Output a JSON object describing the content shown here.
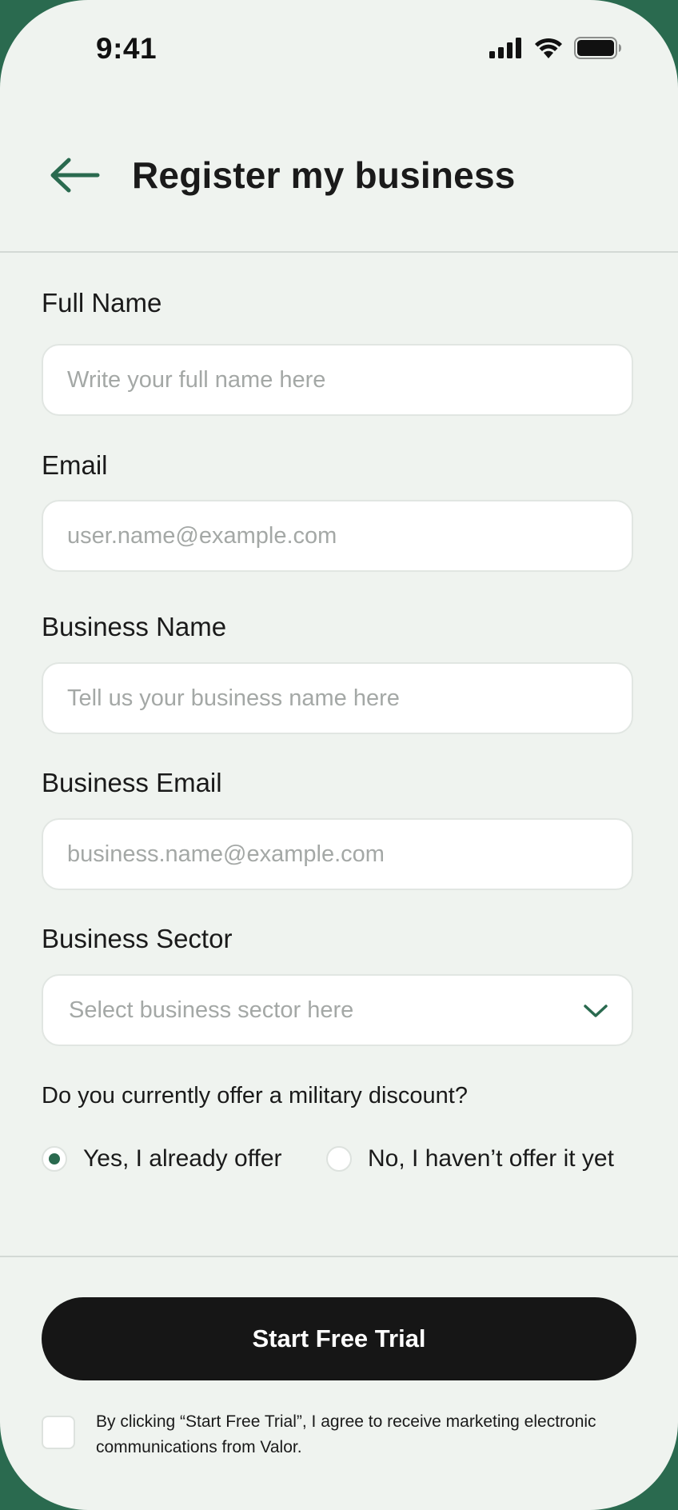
{
  "status_bar": {
    "time": "9:41",
    "icons": [
      "signal-icon",
      "wifi-icon",
      "battery-icon"
    ]
  },
  "header": {
    "back_icon": "arrow-left-icon",
    "title": "Register my business"
  },
  "form": {
    "full_name": {
      "label": "Full Name",
      "placeholder": "Write your full name here",
      "value": ""
    },
    "email": {
      "label": "Email",
      "placeholder": "user.name@example.com",
      "value": ""
    },
    "business_name": {
      "label": "Business Name",
      "placeholder": "Tell us your business name here",
      "value": ""
    },
    "business_email": {
      "label": "Business Email",
      "placeholder": "business.name@example.com",
      "value": ""
    },
    "business_sector": {
      "label": "Business Sector",
      "placeholder": "Select business sector here",
      "icon": "chevron-down-icon"
    },
    "military_discount": {
      "question": "Do you currently offer a military discount?",
      "options": [
        {
          "label": "Yes, I already offer",
          "selected": true
        },
        {
          "label": "No, I haven’t offer it yet",
          "selected": false
        }
      ]
    }
  },
  "cta": {
    "label": "Start Free Trial"
  },
  "consent": {
    "checked": false,
    "text": "By clicking “Start Free Trial”, I agree to receive marketing electronic communications from Valor."
  },
  "colors": {
    "accent": "#2a6a4f",
    "background": "#eff3ef",
    "button": "#161616",
    "placeholder": "#a4a8a6"
  }
}
